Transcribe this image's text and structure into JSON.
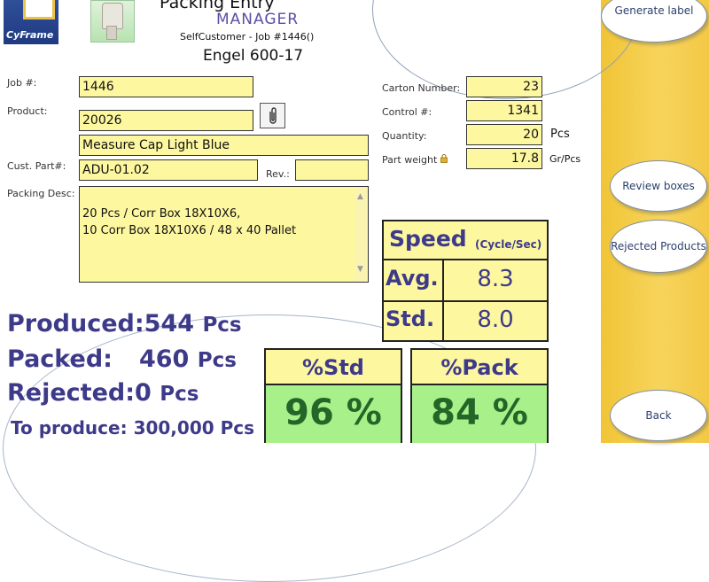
{
  "header": {
    "logo_text": "CyFrame",
    "title": "Packing Entry",
    "subtitle": "MANAGER",
    "customer_job": "SelfCustomer - Job #1446()",
    "job_name": "Engel 600-17"
  },
  "form": {
    "job_label": "Job #:",
    "job_value": "1446",
    "product_label": "Product:",
    "product_value": "20026",
    "product_desc": "Measure Cap Light Blue",
    "cust_part_label": "Cust. Part#:",
    "cust_part_value": "ADU-01.02",
    "rev_label": "Rev.:",
    "rev_value": "",
    "packing_desc_label": "Packing Desc:",
    "packing_desc_value": "20 Pcs  / Corr Box 18X10X6,\n10 Corr Box 18X10X6 / 48 x 40 Pallet",
    "carton_label": "Carton Number:",
    "carton_value": "23",
    "control_label": "Control #:",
    "control_value": "1341",
    "quantity_label": "Quantity:",
    "quantity_value": "20",
    "quantity_unit": "Pcs",
    "part_weight_label": "Part weight",
    "part_weight_value": "17.8",
    "part_weight_unit": "Gr/Pcs"
  },
  "speed": {
    "title": "Speed",
    "unit": "(Cycle/Sec)",
    "avg_label": "Avg.",
    "avg_value": "8.3",
    "std_label": "Std.",
    "std_value": "8.0"
  },
  "stats": {
    "produced_label": "Produced:",
    "produced_value": "544",
    "packed_label": "Packed:",
    "packed_value": "460",
    "rejected_label": "Rejected:",
    "rejected_value": "0",
    "pcs_unit": "Pcs",
    "to_produce_label": "To produce:",
    "to_produce_value": "300,000 Pcs"
  },
  "percent": {
    "std_label": "%Std",
    "std_value": "96 %",
    "pack_label": "%Pack",
    "pack_value": "84 %"
  },
  "buttons": {
    "generate_label": "Generate label",
    "review_boxes": "Review boxes",
    "rejected_products": "Rejected Products",
    "back": "Back"
  },
  "colors": {
    "field_bg": "#fdf7a0",
    "accent_text": "#3e3a8a",
    "percent_bg": "#a8f08a",
    "percent_text": "#226628",
    "side_panel": "#f3c845"
  },
  "icons": {
    "attach": "paperclip-icon",
    "lock": "lock-icon"
  }
}
